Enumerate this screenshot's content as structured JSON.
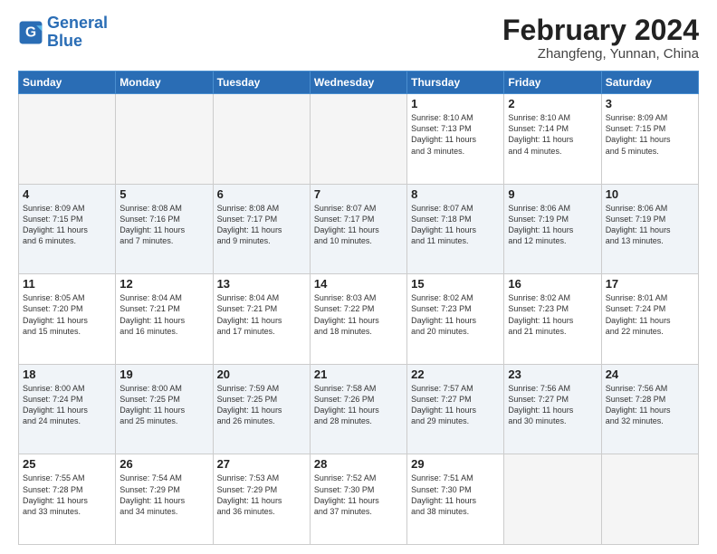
{
  "logo": {
    "line1": "General",
    "line2": "Blue"
  },
  "title": {
    "month_year": "February 2024",
    "location": "Zhangfeng, Yunnan, China"
  },
  "weekdays": [
    "Sunday",
    "Monday",
    "Tuesday",
    "Wednesday",
    "Thursday",
    "Friday",
    "Saturday"
  ],
  "weeks": [
    [
      {
        "num": "",
        "info": "",
        "empty": true
      },
      {
        "num": "",
        "info": "",
        "empty": true
      },
      {
        "num": "",
        "info": "",
        "empty": true
      },
      {
        "num": "",
        "info": "",
        "empty": true
      },
      {
        "num": "1",
        "info": "Sunrise: 8:10 AM\nSunset: 7:13 PM\nDaylight: 11 hours\nand 3 minutes."
      },
      {
        "num": "2",
        "info": "Sunrise: 8:10 AM\nSunset: 7:14 PM\nDaylight: 11 hours\nand 4 minutes."
      },
      {
        "num": "3",
        "info": "Sunrise: 8:09 AM\nSunset: 7:15 PM\nDaylight: 11 hours\nand 5 minutes."
      }
    ],
    [
      {
        "num": "4",
        "info": "Sunrise: 8:09 AM\nSunset: 7:15 PM\nDaylight: 11 hours\nand 6 minutes."
      },
      {
        "num": "5",
        "info": "Sunrise: 8:08 AM\nSunset: 7:16 PM\nDaylight: 11 hours\nand 7 minutes."
      },
      {
        "num": "6",
        "info": "Sunrise: 8:08 AM\nSunset: 7:17 PM\nDaylight: 11 hours\nand 9 minutes."
      },
      {
        "num": "7",
        "info": "Sunrise: 8:07 AM\nSunset: 7:17 PM\nDaylight: 11 hours\nand 10 minutes."
      },
      {
        "num": "8",
        "info": "Sunrise: 8:07 AM\nSunset: 7:18 PM\nDaylight: 11 hours\nand 11 minutes."
      },
      {
        "num": "9",
        "info": "Sunrise: 8:06 AM\nSunset: 7:19 PM\nDaylight: 11 hours\nand 12 minutes."
      },
      {
        "num": "10",
        "info": "Sunrise: 8:06 AM\nSunset: 7:19 PM\nDaylight: 11 hours\nand 13 minutes."
      }
    ],
    [
      {
        "num": "11",
        "info": "Sunrise: 8:05 AM\nSunset: 7:20 PM\nDaylight: 11 hours\nand 15 minutes."
      },
      {
        "num": "12",
        "info": "Sunrise: 8:04 AM\nSunset: 7:21 PM\nDaylight: 11 hours\nand 16 minutes."
      },
      {
        "num": "13",
        "info": "Sunrise: 8:04 AM\nSunset: 7:21 PM\nDaylight: 11 hours\nand 17 minutes."
      },
      {
        "num": "14",
        "info": "Sunrise: 8:03 AM\nSunset: 7:22 PM\nDaylight: 11 hours\nand 18 minutes."
      },
      {
        "num": "15",
        "info": "Sunrise: 8:02 AM\nSunset: 7:23 PM\nDaylight: 11 hours\nand 20 minutes."
      },
      {
        "num": "16",
        "info": "Sunrise: 8:02 AM\nSunset: 7:23 PM\nDaylight: 11 hours\nand 21 minutes."
      },
      {
        "num": "17",
        "info": "Sunrise: 8:01 AM\nSunset: 7:24 PM\nDaylight: 11 hours\nand 22 minutes."
      }
    ],
    [
      {
        "num": "18",
        "info": "Sunrise: 8:00 AM\nSunset: 7:24 PM\nDaylight: 11 hours\nand 24 minutes."
      },
      {
        "num": "19",
        "info": "Sunrise: 8:00 AM\nSunset: 7:25 PM\nDaylight: 11 hours\nand 25 minutes."
      },
      {
        "num": "20",
        "info": "Sunrise: 7:59 AM\nSunset: 7:25 PM\nDaylight: 11 hours\nand 26 minutes."
      },
      {
        "num": "21",
        "info": "Sunrise: 7:58 AM\nSunset: 7:26 PM\nDaylight: 11 hours\nand 28 minutes."
      },
      {
        "num": "22",
        "info": "Sunrise: 7:57 AM\nSunset: 7:27 PM\nDaylight: 11 hours\nand 29 minutes."
      },
      {
        "num": "23",
        "info": "Sunrise: 7:56 AM\nSunset: 7:27 PM\nDaylight: 11 hours\nand 30 minutes."
      },
      {
        "num": "24",
        "info": "Sunrise: 7:56 AM\nSunset: 7:28 PM\nDaylight: 11 hours\nand 32 minutes."
      }
    ],
    [
      {
        "num": "25",
        "info": "Sunrise: 7:55 AM\nSunset: 7:28 PM\nDaylight: 11 hours\nand 33 minutes."
      },
      {
        "num": "26",
        "info": "Sunrise: 7:54 AM\nSunset: 7:29 PM\nDaylight: 11 hours\nand 34 minutes."
      },
      {
        "num": "27",
        "info": "Sunrise: 7:53 AM\nSunset: 7:29 PM\nDaylight: 11 hours\nand 36 minutes."
      },
      {
        "num": "28",
        "info": "Sunrise: 7:52 AM\nSunset: 7:30 PM\nDaylight: 11 hours\nand 37 minutes."
      },
      {
        "num": "29",
        "info": "Sunrise: 7:51 AM\nSunset: 7:30 PM\nDaylight: 11 hours\nand 38 minutes."
      },
      {
        "num": "",
        "info": "",
        "empty": true
      },
      {
        "num": "",
        "info": "",
        "empty": true
      }
    ]
  ]
}
